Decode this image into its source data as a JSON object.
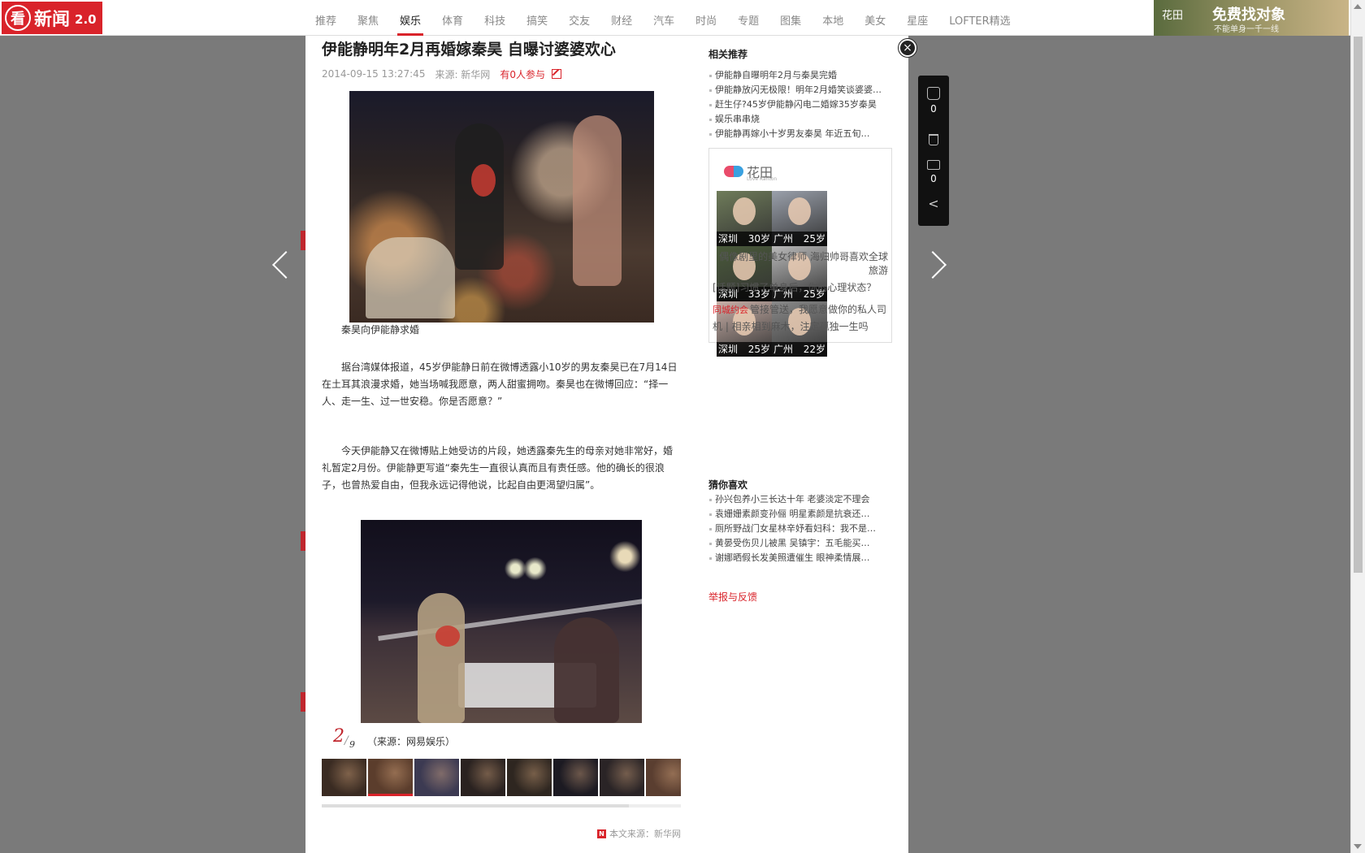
{
  "topbar": {
    "logo_mark": "看",
    "logo_text": "新闻",
    "logo_version": "2.0",
    "nav": [
      {
        "label": "推荐",
        "active": false
      },
      {
        "label": "聚焦",
        "active": false
      },
      {
        "label": "娱乐",
        "active": true
      },
      {
        "label": "体育",
        "active": false
      },
      {
        "label": "科技",
        "active": false
      },
      {
        "label": "搞笑",
        "active": false
      },
      {
        "label": "交友",
        "active": false
      },
      {
        "label": "财经",
        "active": false
      },
      {
        "label": "汽车",
        "active": false
      },
      {
        "label": "时尚",
        "active": false
      },
      {
        "label": "专题",
        "active": false
      },
      {
        "label": "图集",
        "active": false
      },
      {
        "label": "本地",
        "active": false
      },
      {
        "label": "美女",
        "active": false
      },
      {
        "label": "星座",
        "active": false
      },
      {
        "label": "LOFTER精选",
        "active": false
      }
    ],
    "ad": {
      "brand": "花田",
      "title": "免费找对象",
      "subtitle": "不能单身一千一线"
    }
  },
  "article": {
    "title": "伊能静明年2月再婚嫁秦昊 自曝讨婆婆欢心",
    "date": "2014-09-15 13:27:45",
    "source": "来源: 新华网",
    "participants": "有0人参与",
    "caption1": "秦昊向伊能静求婚",
    "paragraph1": "据台湾媒体报道，45岁伊能静日前在微博透露小10岁的男友秦昊已在7月14日在土耳其浪漫求婚，她当场喊我愿意，两人甜蜜拥吻。秦昊也在微博回应：“择一人、走一生、过一世安稳。你是否愿意？”",
    "paragraph2": "今天伊能静又在微博贴上她受访的片段，她透露秦先生的母亲对她非常好，婚礼暂定2月份。伊能静更写道“秦先生一直很认真而且有责任感。他的确长的很浪子，也曾热爱自由，但我永远记得他说，比起自由更渴望归属”。",
    "page_current": "2",
    "page_separator": "/",
    "page_total": "9",
    "caption2": "（来源：网易娱乐）",
    "footer_icon": "N",
    "footer_source": "本文来源：新华网",
    "thumbs": [
      {
        "color": "#3a2b22",
        "active": false
      },
      {
        "color": "#5b3d2c",
        "active": true
      },
      {
        "color": "#3c3a52",
        "active": false
      },
      {
        "color": "#2a2220",
        "active": false
      },
      {
        "color": "#2e2620",
        "active": false
      },
      {
        "color": "#1c1a22",
        "active": false
      },
      {
        "color": "#2a2426",
        "active": false
      },
      {
        "color": "#5a3e30",
        "active": false
      }
    ]
  },
  "sidebar": {
    "related_title": "相关推荐",
    "related": [
      "伊能静自曝明年2月与秦昊完婚",
      "伊能静放闪无极限！明年2月婚笑谈婆婆…",
      "赶生仔?45岁伊能静闪电二婚嫁35岁秦昊",
      "娱乐串串烧",
      "伊能静再嫁小十岁男友秦昊 年近五旬…"
    ],
    "huatian": {
      "logo": "花田",
      "logo_sub": "Love Kanton",
      "cards": [
        {
          "city": "深圳",
          "age": "30岁",
          "color": "#6f7c5a"
        },
        {
          "city": "广州",
          "age": "25岁",
          "color": "#9aa0ab"
        },
        {
          "city": "深圳",
          "age": "33岁",
          "color": "#4a5a3a"
        },
        {
          "city": "广州",
          "age": "25岁",
          "color": "#b8b8b8"
        },
        {
          "city": "深圳",
          "age": "25岁",
          "color": "#c9b0a8"
        },
        {
          "city": "广州",
          "age": "22岁",
          "color": "#8a8a8a"
        }
      ],
      "link1": "偶像剧里的美女律师 海归帅哥喜欢全球旅游",
      "link2": "[话题]习惯了单身后，你的心理状态？",
      "link3_tag": "同城约会",
      "link3": "管接管送，我愿意做你的私人司机 | 相亲相到麻木，注定孤独一生吗"
    },
    "guess_title": "猜你喜欢",
    "guess": [
      "孙兴包养小三长达十年 老婆淡定不理会",
      "袁姗姗素颜变孙俪 明星素颜是抗衰还…",
      "厕所野战门女星林辛妤看妇科：我不是…",
      "黄晏受伤贝儿被黑 吴镇宇：五毛能买…",
      "谢娜晒假长发美照遭催生 眼神柔情展…"
    ],
    "report": "举报与反馈"
  },
  "rail": {
    "likes": "0",
    "comments": "0"
  },
  "icons": {
    "close": "×",
    "share": "<"
  }
}
